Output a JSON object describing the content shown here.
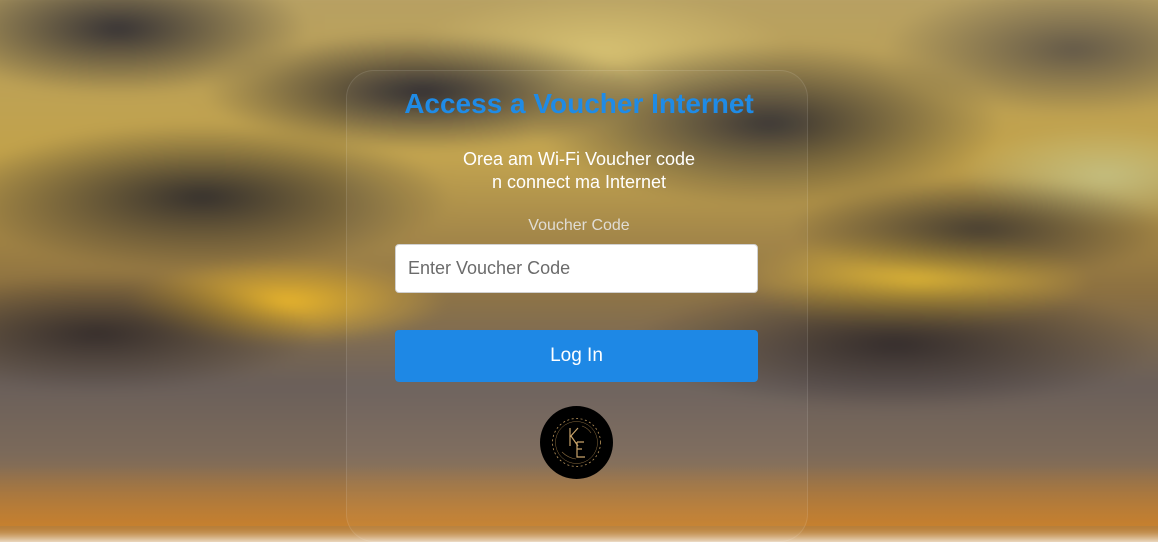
{
  "page": {
    "title": "Access a Voucher Internet",
    "subtitle_line1": "Orea am Wi-Fi Voucher code",
    "subtitle_line2": "n connect ma Internet"
  },
  "form": {
    "voucher_label": "Voucher Code",
    "voucher_placeholder": "Enter Voucher Code",
    "voucher_value": "",
    "login_label": "Log In"
  },
  "logo": {
    "icon": "ke-monogram-logo"
  },
  "colors": {
    "title": "#1f8be6",
    "button": "#1e88e5",
    "logo_gold": "#b8935a"
  }
}
